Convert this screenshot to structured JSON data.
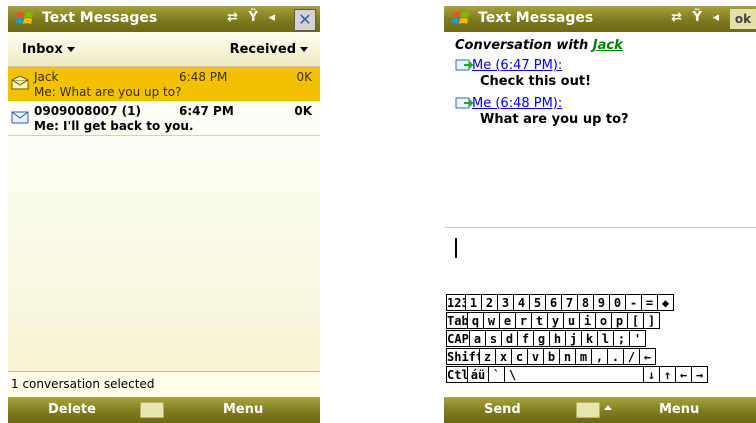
{
  "left": {
    "title": "Text Messages",
    "status_icons": "⇄ Ÿ ◂",
    "close_label": "✕",
    "filter": {
      "folder": "Inbox",
      "sort": "Received"
    },
    "messages": [
      {
        "sender": "Jack",
        "time": "6:48 PM",
        "size": "0K",
        "preview": "Me: What are you up to?",
        "selected": true
      },
      {
        "sender": "0909008007 (1)",
        "time": "6:47 PM",
        "size": "0K",
        "preview": "Me: I'll get back to you.",
        "selected": false
      }
    ],
    "status_text": "1 conversation selected",
    "softkeys": {
      "left": "Delete",
      "right": "Menu"
    }
  },
  "right": {
    "title": "Text Messages",
    "status_icons": "⇄ Ÿ ◂",
    "ok_label": "ok",
    "conversation_prefix": "Conversation with",
    "contact": "Jack",
    "messages": [
      {
        "header": "Me (6:47 PM):",
        "text": "Check this out!"
      },
      {
        "header": "Me (6:48 PM):",
        "text": "What are you up to?"
      }
    ],
    "keyboard": {
      "row1": [
        "123",
        "1",
        "2",
        "3",
        "4",
        "5",
        "6",
        "7",
        "8",
        "9",
        "0",
        "-",
        "=",
        "◆"
      ],
      "row2": [
        "Tab",
        "q",
        "w",
        "e",
        "r",
        "t",
        "y",
        "u",
        "i",
        "o",
        "p",
        "[",
        "]"
      ],
      "row3": [
        "CAP",
        "a",
        "s",
        "d",
        "f",
        "g",
        "h",
        "j",
        "k",
        "l",
        ";",
        "'"
      ],
      "row4": [
        "Shift",
        "z",
        "x",
        "c",
        "v",
        "b",
        "n",
        "m",
        ",",
        ".",
        "/",
        "←"
      ],
      "row5": [
        "Ctl",
        "áü",
        "`",
        "\\",
        "↓",
        "↑",
        "←",
        "→"
      ]
    },
    "softkeys": {
      "left": "Send",
      "right": "Menu"
    }
  }
}
